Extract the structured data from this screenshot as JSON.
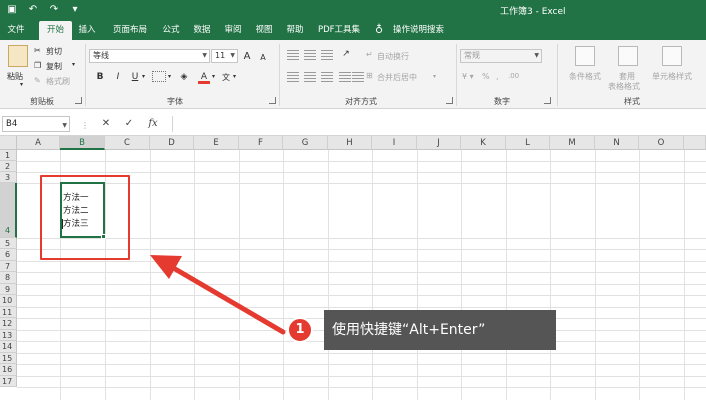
{
  "titlebar": {
    "title": "工作簿3 - Excel",
    "qat_save_icon": "save-icon",
    "qat_undo_icon": "undo-icon",
    "qat_redo_icon": "redo-icon"
  },
  "menu": {
    "tabs": [
      "文件",
      "开始",
      "插入",
      "页面布局",
      "公式",
      "数据",
      "审阅",
      "视图",
      "帮助",
      "PDF工具集"
    ],
    "active_tab": "开始",
    "tell_me": "操作说明搜索"
  },
  "ribbon": {
    "clipboard": {
      "label": "剪贴板",
      "paste": "粘贴",
      "cut": "剪切",
      "copy": "复制",
      "format_painter": "格式刷"
    },
    "font": {
      "label": "字体",
      "font_name": "等线",
      "font_size": "11",
      "bold": "B",
      "italic": "I",
      "underline": "U",
      "grow": "A",
      "shrink": "A",
      "font_color": "A"
    },
    "alignment": {
      "label": "对齐方式",
      "wrap_text": "自动换行",
      "merge_center": "合并后居中"
    },
    "number": {
      "label": "数字",
      "format": "常规",
      "percent": "%",
      "comma": ",",
      "inc_dec": ".00"
    },
    "styles": {
      "label": "样式",
      "conditional": "条件格式",
      "as_table": "套用",
      "as_table2": "表格格式",
      "cell_styles": "单元格样式"
    }
  },
  "formula_bar": {
    "name_box": "B4",
    "cancel": "✕",
    "enter": "✓",
    "fx": "fx"
  },
  "grid": {
    "columns": [
      "A",
      "B",
      "C",
      "D",
      "E",
      "F",
      "G",
      "H",
      "I",
      "J",
      "K",
      "L",
      "M",
      "N",
      "O"
    ],
    "rows": [
      "1",
      "2",
      "3",
      "4",
      "5",
      "6",
      "7",
      "8",
      "9",
      "10",
      "11",
      "12",
      "13",
      "14",
      "15",
      "16",
      "17"
    ],
    "selected_column": "B",
    "selected_row": "4",
    "cell_lines": [
      "方法一",
      "方法二",
      "方法三"
    ]
  },
  "annotation": {
    "badge": "1",
    "text": "使用快捷键“Alt+Enter”",
    "color": "#e53a2f"
  },
  "colors": {
    "excel_green": "#217346",
    "callout_bg": "#555555"
  }
}
